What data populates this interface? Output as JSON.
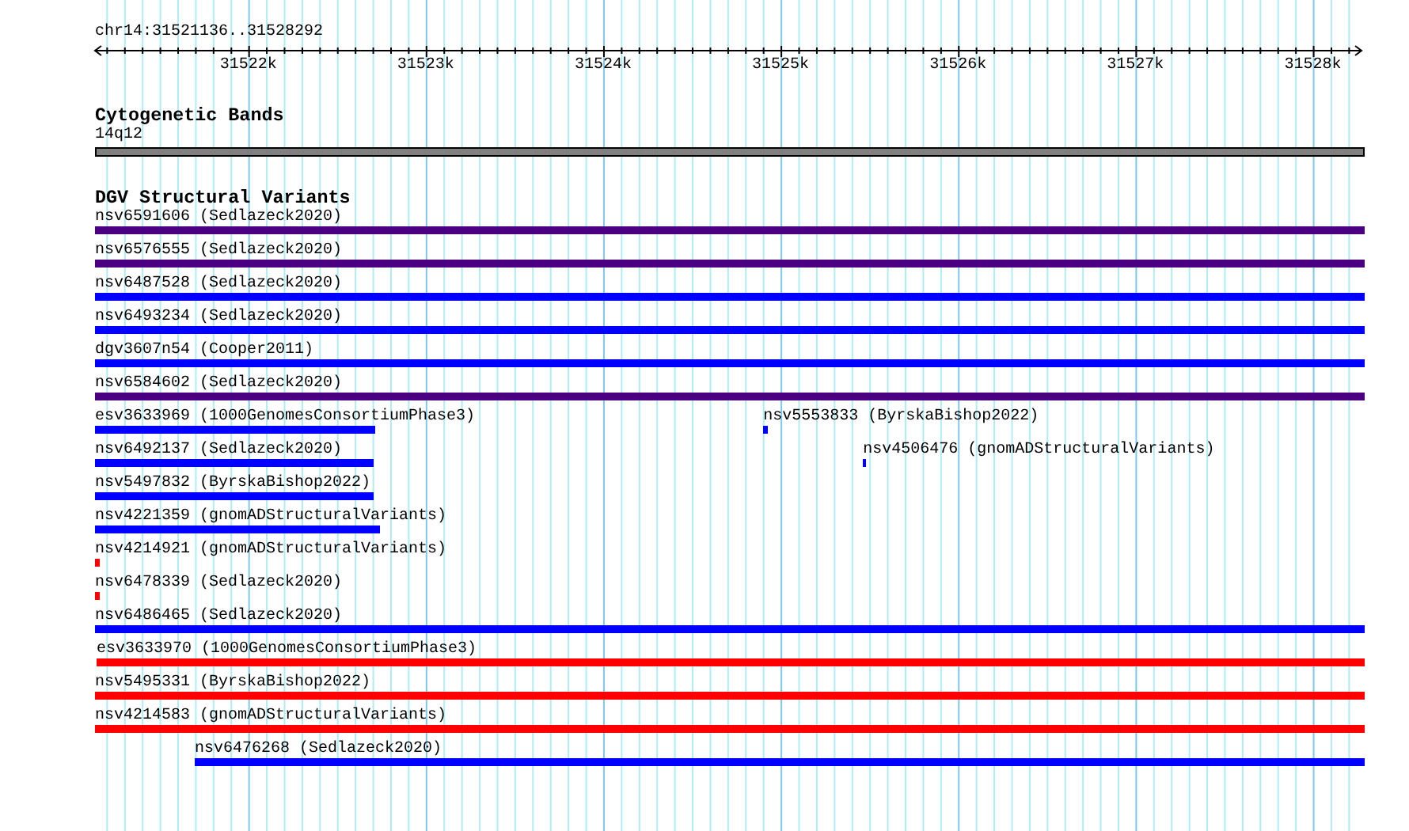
{
  "region": {
    "title": "chr14:31521136..31528292"
  },
  "ruler": {
    "ticks": [
      {
        "label": "31522k"
      },
      {
        "label": "31523k"
      },
      {
        "label": "31524k"
      },
      {
        "label": "31525k"
      },
      {
        "label": "31526k"
      },
      {
        "label": "31527k"
      },
      {
        "label": "31528k"
      }
    ]
  },
  "cytoband": {
    "title": "Cytogenetic Bands",
    "label": "14q12",
    "color": "#808080"
  },
  "tracks": [
    {
      "title": "DGV Structural Variants",
      "lanes": [
        {
          "features": [
            {
              "label": "nsv6591606 (Sedlazeck2020)",
              "color": "#4b0082"
            }
          ]
        },
        {
          "features": [
            {
              "label": "nsv6576555 (Sedlazeck2020)",
              "color": "#4b0082"
            }
          ]
        },
        {
          "features": [
            {
              "label": "nsv6487528 (Sedlazeck2020)",
              "color": "#0000ff"
            }
          ]
        },
        {
          "features": [
            {
              "label": "nsv6493234 (Sedlazeck2020)",
              "color": "#0000ff"
            }
          ]
        },
        {
          "features": [
            {
              "label": "dgv3607n54 (Cooper2011)",
              "color": "#0000ff"
            }
          ]
        },
        {
          "features": [
            {
              "label": "nsv6584602 (Sedlazeck2020)",
              "color": "#4b0082"
            }
          ]
        },
        {
          "features": [
            {
              "label": "esv3633969 (1000GenomesConsortiumPhase3)",
              "color": "#0000ff"
            },
            {
              "label": "nsv5553833 (ByrskaBishop2022)",
              "color": "#0000ff"
            }
          ]
        },
        {
          "features": [
            {
              "label": "nsv6492137 (Sedlazeck2020)",
              "color": "#0000ff"
            },
            {
              "label": "nsv4506476 (gnomADStructuralVariants)",
              "color": "#0000ff"
            }
          ]
        },
        {
          "features": [
            {
              "label": "nsv5497832 (ByrskaBishop2022)",
              "color": "#0000ff"
            }
          ]
        },
        {
          "features": [
            {
              "label": "nsv4221359 (gnomADStructuralVariants)",
              "color": "#0000ff"
            }
          ]
        },
        {
          "features": [
            {
              "label": "nsv4214921 (gnomADStructuralVariants)",
              "color": "#ff0000"
            }
          ]
        },
        {
          "features": [
            {
              "label": "nsv6478339 (Sedlazeck2020)",
              "color": "#ff0000"
            }
          ]
        },
        {
          "features": [
            {
              "label": "nsv6486465 (Sedlazeck2020)",
              "color": "#0000ff"
            }
          ]
        },
        {
          "features": [
            {
              "label": "esv3633970 (1000GenomesConsortiumPhase3)",
              "color": "#ff0000"
            }
          ]
        },
        {
          "features": [
            {
              "label": "nsv5495331 (ByrskaBishop2022)",
              "color": "#ff0000"
            }
          ]
        },
        {
          "features": [
            {
              "label": "nsv4214583 (gnomADStructuralVariants)",
              "color": "#ff0000"
            }
          ]
        },
        {
          "features": [
            {
              "label": "nsv6476268 (Sedlazeck2020)",
              "color": "#0000ff"
            }
          ]
        }
      ]
    }
  ]
}
